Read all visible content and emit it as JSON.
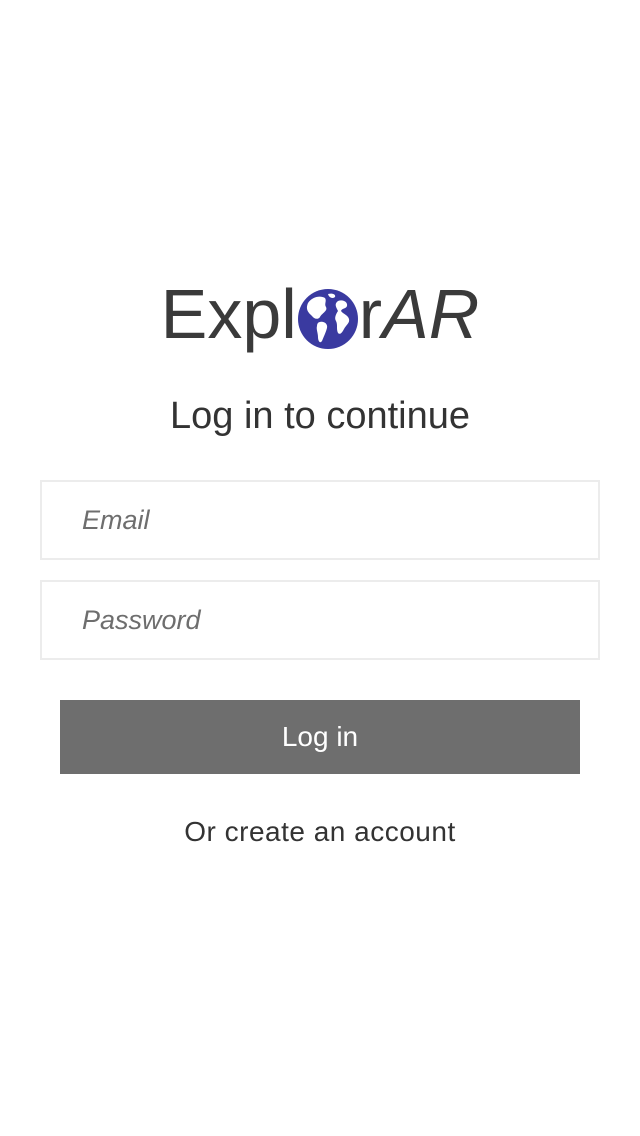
{
  "logo": {
    "text_before": "Expl",
    "text_middle": "r",
    "text_italic": "AR",
    "globe_icon": "globe-icon",
    "globe_color": "#3a3aa0"
  },
  "subtitle": "Log in to continue",
  "form": {
    "email_placeholder": "Email",
    "email_value": "",
    "password_placeholder": "Password",
    "password_value": ""
  },
  "login_button_label": "Log in",
  "create_account_label": "Or create an account",
  "colors": {
    "button_bg": "#6e6e6e",
    "text": "#333333",
    "field_border": "#ececec"
  }
}
